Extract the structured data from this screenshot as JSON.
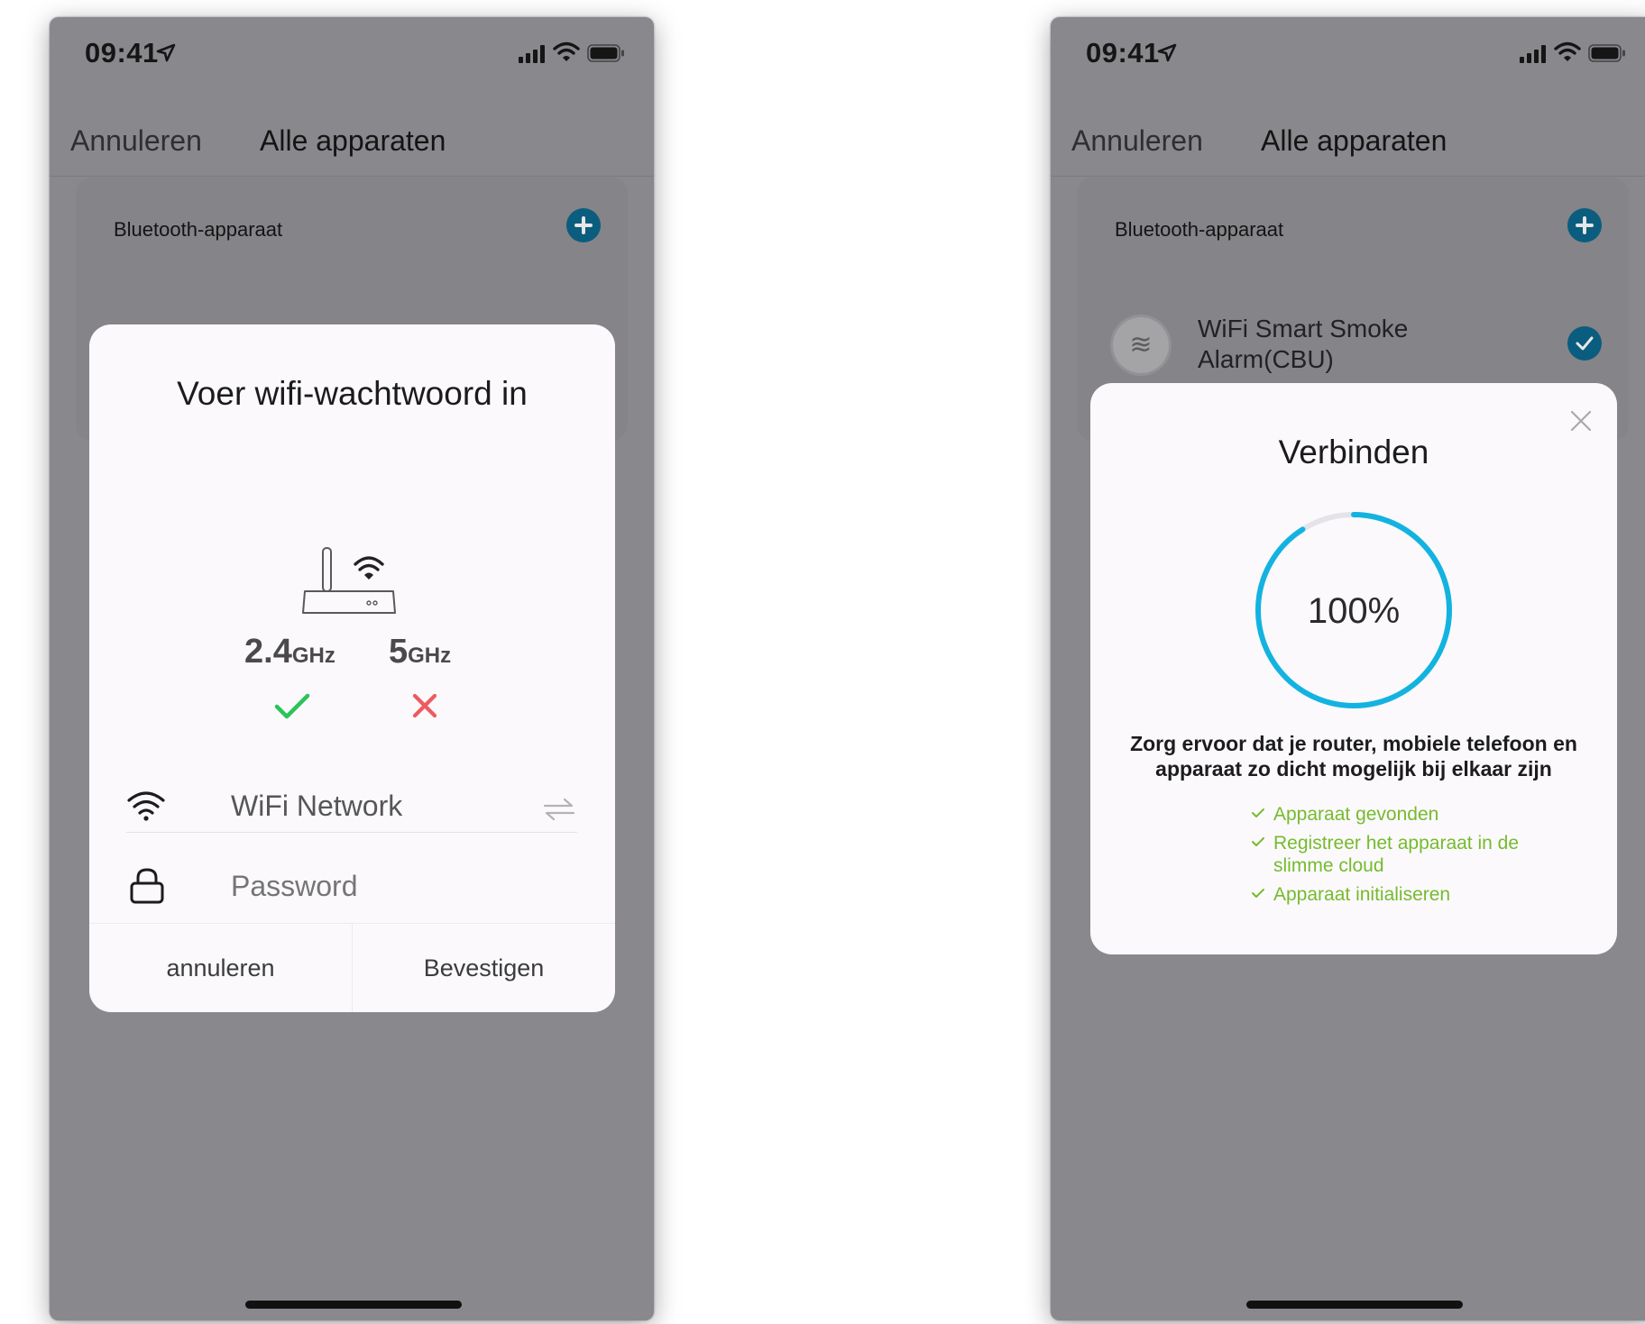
{
  "colors": {
    "accent": "#0a5d7e",
    "progress": "#12b3e0",
    "success": "#2bc45a",
    "error": "#ee5a5e",
    "step_text": "#76bb2d"
  },
  "left_screen": {
    "status": {
      "time": "09:41"
    },
    "nav": {
      "cancel": "Annuleren",
      "title": "Alle apparaten"
    },
    "list": {
      "header": "Bluetooth-apparaat"
    },
    "dialog": {
      "title": "Voer wifi-wachtwoord in",
      "illustration": "router-icon",
      "bands": [
        {
          "value": "2.4",
          "unit": "GHz",
          "supported": true
        },
        {
          "value": "5",
          "unit": "GHz",
          "supported": false
        }
      ],
      "network_field": "WiFi Network",
      "password_placeholder": "Password",
      "cancel_button": "annuleren",
      "confirm_button": "Bevestigen"
    }
  },
  "right_screen": {
    "status": {
      "time": "09:41"
    },
    "nav": {
      "cancel": "Annuleren",
      "title": "Alle apparaten"
    },
    "list": {
      "header": "Bluetooth-apparaat",
      "device": {
        "name": "WiFi Smart Smoke Alarm(CBU)",
        "icon": "smoke-alarm-icon",
        "selected": true
      }
    },
    "dialog": {
      "title": "Verbinden",
      "progress": 100,
      "progress_label": "100%",
      "hint": "Zorg ervoor dat je router, mobiele telefoon en apparaat zo dicht mogelijk bij elkaar zijn",
      "steps": [
        "Apparaat gevonden",
        "Registreer het apparaat in de slimme cloud",
        "Apparaat initialiseren"
      ]
    }
  }
}
